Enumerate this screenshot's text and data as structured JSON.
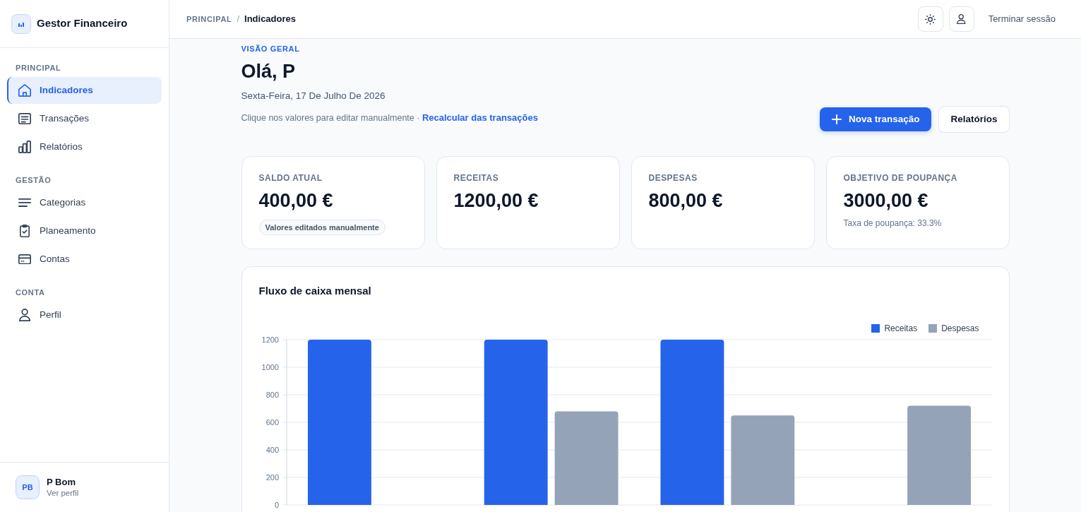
{
  "sidebar": {
    "brand": "Gestor Financeiro",
    "sections": [
      {
        "title": "PRINCIPAL",
        "items": [
          {
            "label": "Indicadores",
            "selected": true
          },
          {
            "label": "Transações",
            "selected": false
          },
          {
            "label": "Relatórios",
            "selected": false
          }
        ]
      },
      {
        "title": "GESTÃO",
        "items": [
          {
            "label": "Categorias",
            "selected": false
          },
          {
            "label": "Planeamento",
            "selected": false
          },
          {
            "label": "Contas",
            "selected": false
          }
        ]
      },
      {
        "title": "CONTA",
        "items": [
          {
            "label": "Perfil",
            "selected": false
          }
        ]
      }
    ],
    "user": {
      "initials": "PB",
      "name": "P Bom",
      "link": "Ver perfil"
    }
  },
  "header": {
    "breadcrumb": {
      "section": "PRINCIPAL",
      "separator": "/",
      "current": "Indicadores"
    },
    "logout": "Terminar sessão"
  },
  "hero": {
    "eyebrow": "VISÃO GERAL",
    "greeting": "Olá, P",
    "date": "Sexta-Feira, 17 De Julho De 2026",
    "hint": "Clique nos valores para editar manualmente ·",
    "hint_link": "Recalcular das transações",
    "buttons": [
      {
        "label": "Nova transação",
        "kind": "primary"
      },
      {
        "label": "Relatórios",
        "kind": "outline"
      }
    ]
  },
  "stats": [
    {
      "label": "SALDO ATUAL",
      "value": "400,00 €",
      "badge": "Valores editados manualmente"
    },
    {
      "label": "RECEITAS",
      "value": "1200,00 €"
    },
    {
      "label": "DESPESAS",
      "value": "800,00 €"
    },
    {
      "label": "OBJETIVO DE POUPANÇA",
      "value": "3000,00 €",
      "note": "Taxa de poupança: 33.3%"
    }
  ],
  "chart": {
    "chart_data": {
      "type": "bar",
      "title": "Fluxo de caixa mensal",
      "series": [
        {
          "name": "Receitas",
          "color": "#2563eb",
          "values": [
            1200,
            1200,
            1200,
            null
          ]
        },
        {
          "name": "Despesas",
          "color": "#94a3b8",
          "values": [
            null,
            680,
            650,
            720
          ]
        }
      ],
      "ylim": [
        0,
        1200
      ],
      "yticks": [
        0,
        200,
        400,
        600,
        800,
        1000,
        1200
      ],
      "grid": true,
      "legend": true
    }
  }
}
